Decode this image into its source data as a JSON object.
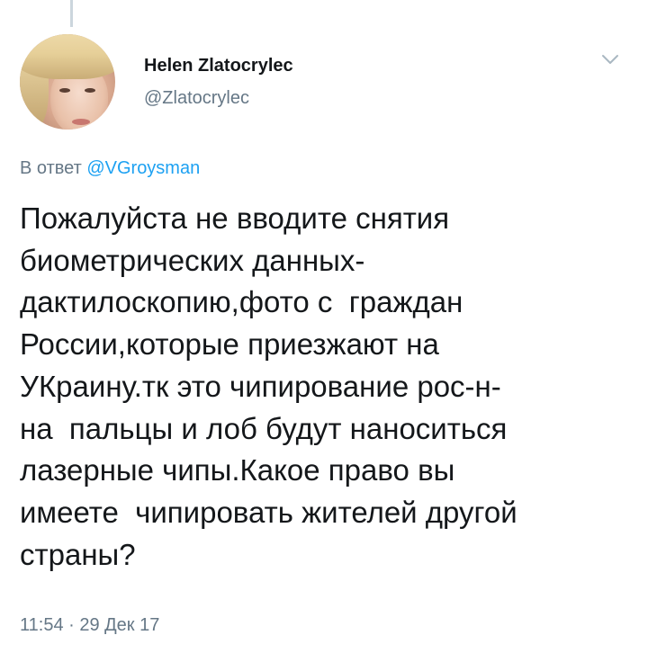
{
  "tweet": {
    "author_name": "Helen Zlatocrylec",
    "author_handle": "@Zlatocrylec",
    "reply_prefix": "В ответ ",
    "reply_mention": "@VGroysman",
    "text": "Пожалуйста не вводите снятия\nбиометрических данных-\nдактилоскопию,фото с  граждан\nРоссии,которые приезжают на\nУКраину.тк это чипирование рос-н-\nна  пальцы и лоб будут наноситься\nлазерные чипы.Какое право вы\nимеете  чипировать жителей другой\nстраны?",
    "timestamp": "11:54 · 29 Дек 17"
  },
  "icons": {
    "menu": "chevron-down-icon",
    "avatar": "avatar"
  },
  "colors": {
    "text": "#14171a",
    "secondary": "#657786",
    "link": "#1da1f2",
    "thread_line": "#ccd6dd"
  }
}
